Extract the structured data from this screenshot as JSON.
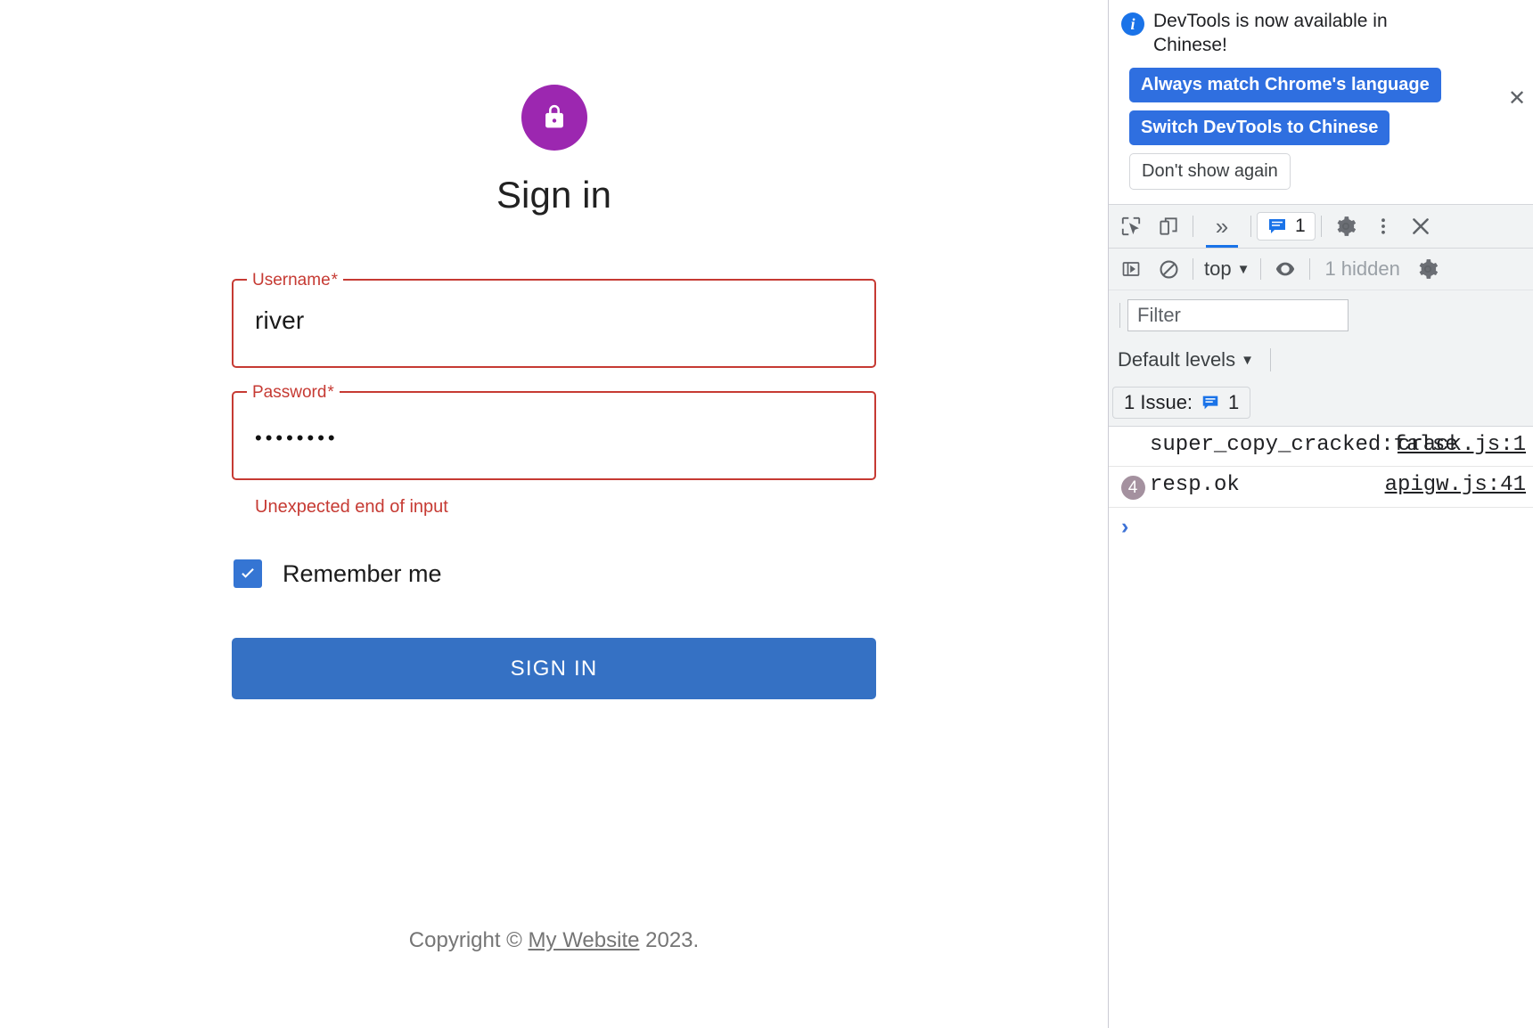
{
  "page": {
    "title": "Sign in",
    "avatar_icon": "lock-icon",
    "avatar_color": "#9c27b0",
    "username_field": {
      "label": "Username",
      "required_mark": "*",
      "value": "river",
      "state": "error"
    },
    "password_field": {
      "label": "Password",
      "required_mark": "*",
      "value": "••••••••",
      "state": "error"
    },
    "error_text": "Unexpected end of input",
    "remember": {
      "label": "Remember me",
      "checked": true,
      "color": "#3575d3"
    },
    "submit": {
      "label": "SIGN IN",
      "color": "#3571c4"
    },
    "footer": {
      "prefix": "Copyright © ",
      "link": "My Website",
      "suffix": " 2023."
    },
    "error_color": "#c63a33"
  },
  "devtools": {
    "banner": {
      "icon": "info-icon",
      "message": "DevTools is now available in Chinese!",
      "primary_action_1": "Always match Chrome's language",
      "primary_action_2": "Switch DevTools to Chinese",
      "secondary_action": "Don't show again",
      "close_label": "✕"
    },
    "toolbar": {
      "inspect_icon": "inspect-element-icon",
      "device_icon": "device-toolbar-icon",
      "overflow_label": "»",
      "issues_count": "1",
      "issues_icon": "issues-message-icon",
      "settings_icon": "gear-icon",
      "more_icon": "kebab-menu-icon",
      "close_icon": "close-icon"
    },
    "console_bar": {
      "sidebar_icon": "console-sidebar-icon",
      "clear_icon": "clear-console-icon",
      "context": "top",
      "context_caret": "▼",
      "eye_icon": "live-expression-eye-icon",
      "hidden_text": "1 hidden",
      "settings_icon": "gear-icon"
    },
    "filter": {
      "placeholder": "Filter",
      "value": ""
    },
    "levels": {
      "label": "Default levels",
      "caret": "▼"
    },
    "issues_pill": {
      "text": "1 Issue:",
      "icon": "issues-message-icon",
      "count": "1"
    },
    "messages": [
      {
        "text": "super_copy_cracked:false",
        "source": "crack.js:1",
        "count": null
      },
      {
        "text": "resp.ok",
        "source": "apigw.js:41",
        "count": "4"
      }
    ],
    "prompt_caret": "›"
  }
}
